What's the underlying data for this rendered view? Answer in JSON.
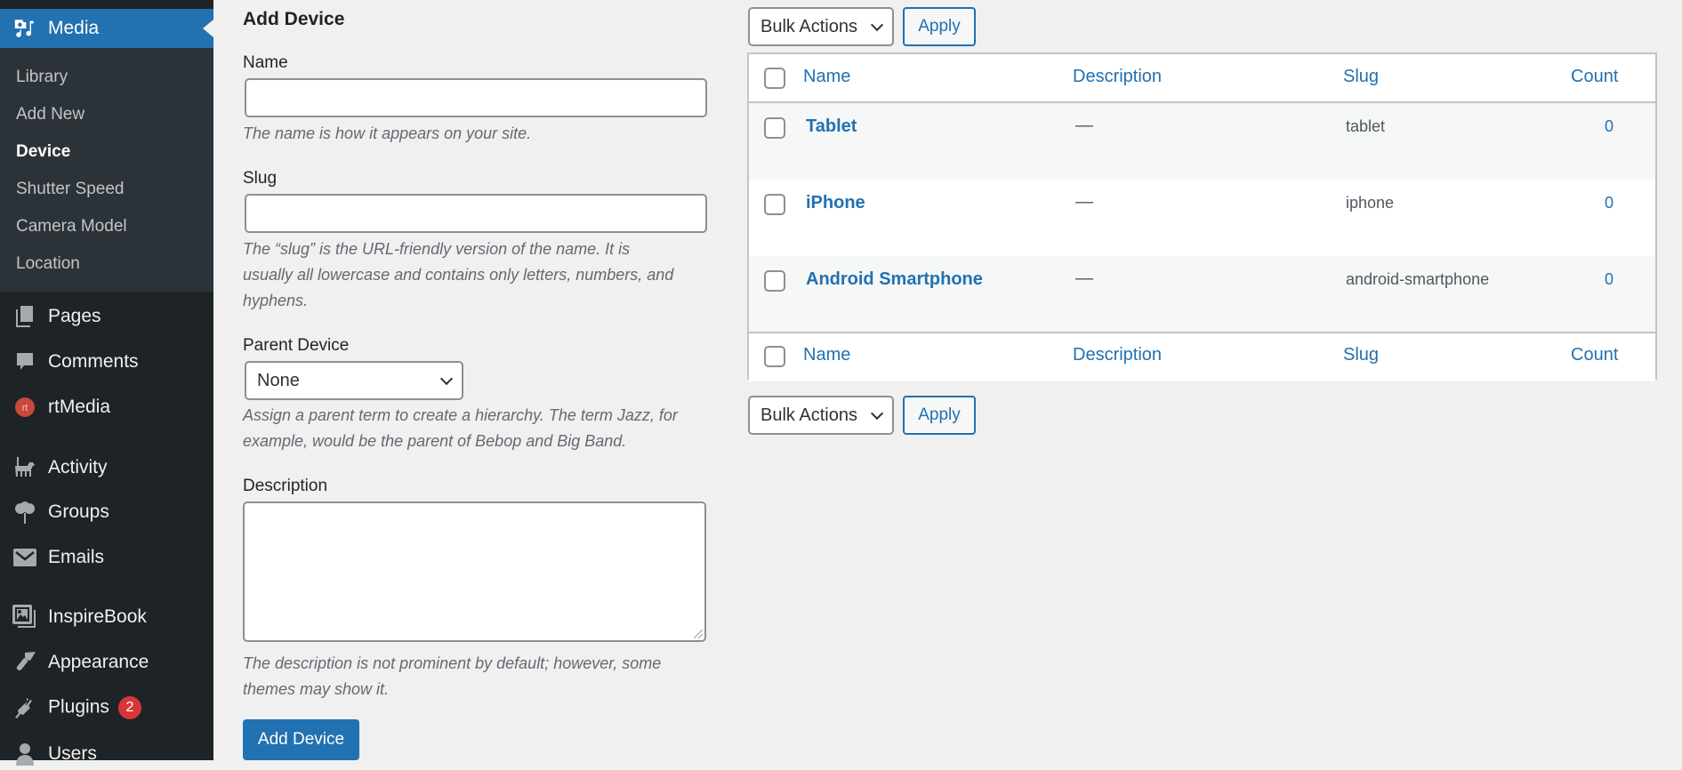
{
  "sidebar": {
    "current_menu": {
      "label": "Media",
      "icon": "media-icon"
    },
    "submenu": [
      {
        "label": "Library",
        "current": false
      },
      {
        "label": "Add New",
        "current": false
      },
      {
        "label": "Device",
        "current": true
      },
      {
        "label": "Shutter Speed",
        "current": false
      },
      {
        "label": "Camera Model",
        "current": false
      },
      {
        "label": "Location",
        "current": false
      }
    ],
    "items": [
      {
        "label": "Pages",
        "icon": "pages-icon"
      },
      {
        "label": "Comments",
        "icon": "comments-icon"
      },
      {
        "label": "rtMedia",
        "icon": "rtmedia-icon"
      },
      {
        "label": "Activity",
        "icon": "activity-icon"
      },
      {
        "label": "Groups",
        "icon": "groups-icon"
      },
      {
        "label": "Emails",
        "icon": "emails-icon"
      },
      {
        "label": "InspireBook",
        "icon": "inspirebook-icon"
      },
      {
        "label": "Appearance",
        "icon": "appearance-icon"
      },
      {
        "label": "Plugins",
        "icon": "plugins-icon",
        "badge": "2"
      },
      {
        "label": "Users",
        "icon": "users-icon"
      }
    ]
  },
  "form": {
    "title": "Add Device",
    "name_label": "Name",
    "name_value": "",
    "name_help": "The name is how it appears on your site.",
    "slug_label": "Slug",
    "slug_value": "",
    "slug_help_1": "The “slug” is the URL-friendly version of the name. It is",
    "slug_help_2": "usually all lowercase and contains only letters, numbers, and",
    "slug_help_3": "hyphens.",
    "parent_label": "Parent Device",
    "parent_value": "None",
    "parent_help_1": "Assign a parent term to create a hierarchy. The term Jazz, for",
    "parent_help_2": "example, would be the parent of Bebop and Big Band.",
    "description_label": "Description",
    "description_value": "",
    "description_help_1": "The description is not prominent by default; however, some",
    "description_help_2": "themes may show it.",
    "submit_label": "Add Device"
  },
  "bulk": {
    "select_label": "Bulk Actions",
    "apply_label": "Apply"
  },
  "table": {
    "columns": {
      "name": "Name",
      "description": "Description",
      "slug": "Slug",
      "count": "Count"
    },
    "rows": [
      {
        "name": "Tablet",
        "description": "—",
        "slug": "tablet",
        "count": "0"
      },
      {
        "name": "iPhone",
        "description": "—",
        "slug": "iphone",
        "count": "0"
      },
      {
        "name": "Android Smartphone",
        "description": "—",
        "slug": "android-smartphone",
        "count": "0"
      }
    ]
  },
  "colors": {
    "accent": "#2271b1",
    "sidebar_bg": "#1d2327",
    "submenu_bg": "#2c3338",
    "badge": "#d63638"
  }
}
